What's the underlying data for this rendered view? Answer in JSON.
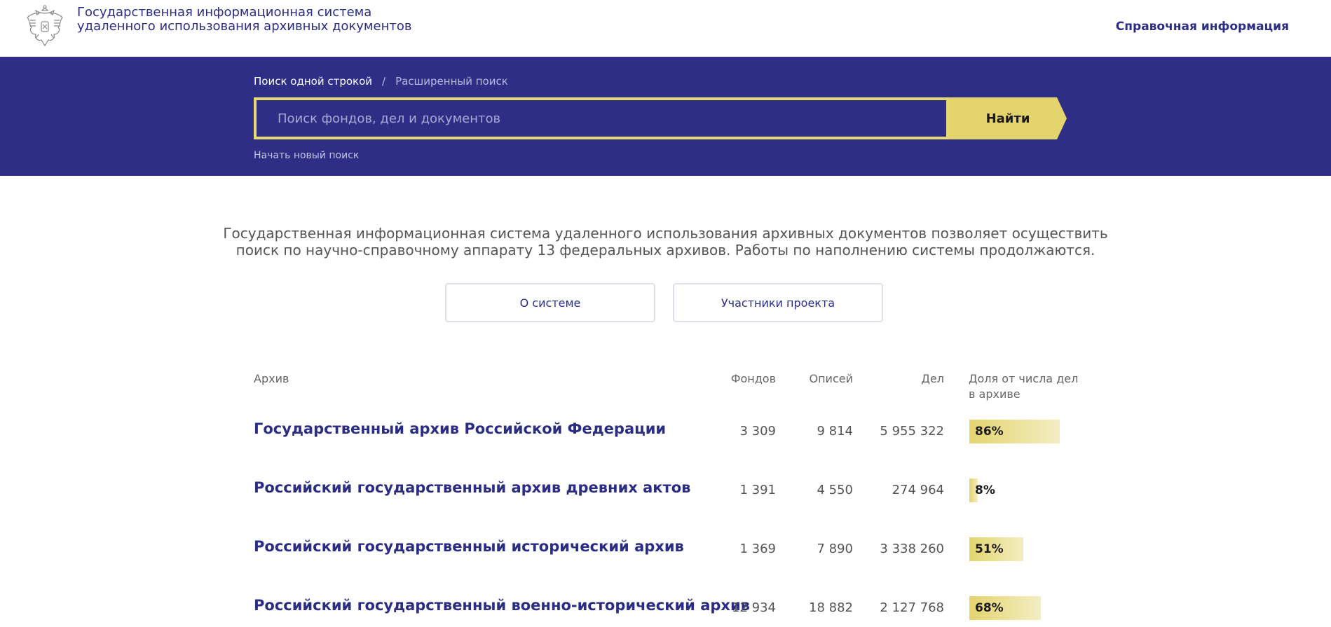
{
  "header": {
    "title_line1": "Государственная информационная система",
    "title_line2": "удаленного использования архивных документов",
    "help_link": "Справочная информация",
    "emblem_icon": "coat-of-arms-icon"
  },
  "search": {
    "tab_simple": "Поиск одной строкой",
    "tab_separator": "/",
    "tab_advanced": "Расширенный поиск",
    "placeholder": "Поиск фондов, дел и документов",
    "value": "",
    "button": "Найти",
    "new_search": "Начать новый поиск"
  },
  "intro": {
    "line1": "Государственная информационная система удаленного использования архивных документов позволяет осуществить",
    "line2": "поиск по научно-справочному аппарату 13 федеральных архивов. Работы по наполнению системы продолжаются."
  },
  "buttons": {
    "about": "О системе",
    "members": "Участники проекта"
  },
  "table": {
    "headers": {
      "archive": "Архив",
      "funds": "Фондов",
      "inventories": "Описей",
      "cases": "Дел",
      "share_line1": "Доля от числа дел",
      "share_line2": "в архиве"
    },
    "rows": [
      {
        "name": "Государственный архив Российской Федерации",
        "funds": "3 309",
        "inventories": "9 814",
        "cases": "5 955 322",
        "share": "86%",
        "share_value": 0.86
      },
      {
        "name": "Российский государственный архив древних актов",
        "funds": "1 391",
        "inventories": "4 550",
        "cases": "274 964",
        "share": "8%",
        "share_value": 0.08
      },
      {
        "name": "Российский государственный исторический архив",
        "funds": "1 369",
        "inventories": "7 890",
        "cases": "3 338 260",
        "share": "51%",
        "share_value": 0.51
      },
      {
        "name": "Российский государственный военно-исторический архив",
        "funds": "12 934",
        "inventories": "18 882",
        "cases": "2 127 768",
        "share": "68%",
        "share_value": 0.68
      }
    ]
  },
  "colors": {
    "brand": "#2e2e87",
    "accent": "#e3d46e",
    "link": "#2b2c84"
  }
}
